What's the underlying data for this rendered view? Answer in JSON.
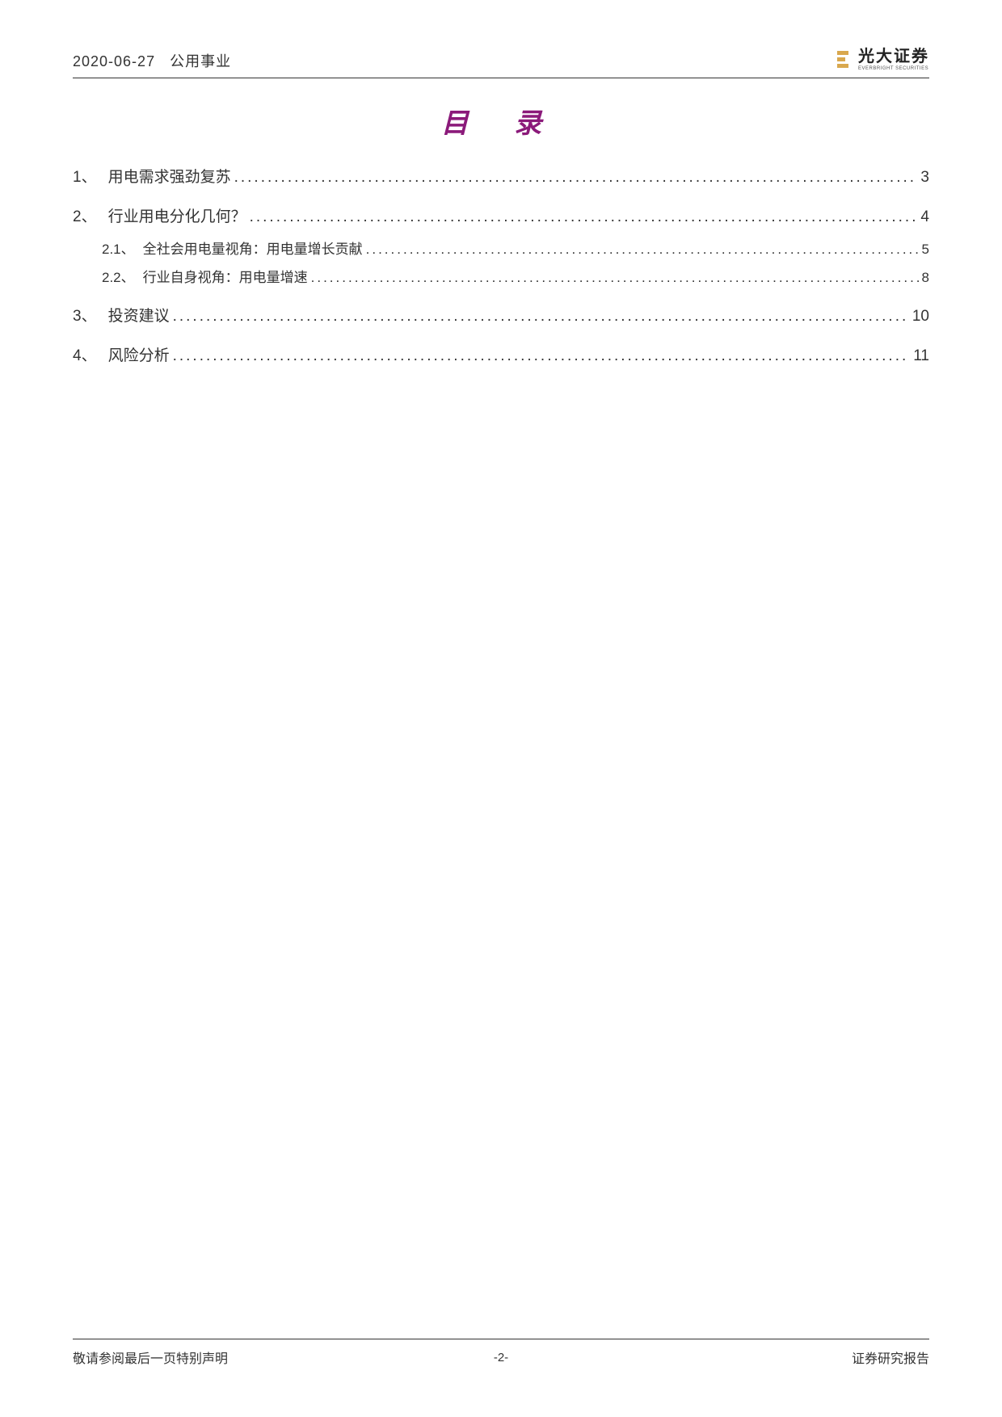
{
  "header": {
    "date": "2020-06-27",
    "category": "公用事业",
    "logo_cn": "光大证券",
    "logo_en": "EVERBRIGHT SECURITIES"
  },
  "title": "目 录",
  "toc": [
    {
      "level": 1,
      "num": "1、",
      "label": "用电需求强劲复苏",
      "page": "3"
    },
    {
      "level": 1,
      "num": "2、",
      "label": "行业用电分化几何？",
      "page": "4"
    },
    {
      "level": 2,
      "num": "2.1、",
      "label": "全社会用电量视角：用电量增长贡献",
      "page": "5"
    },
    {
      "level": 2,
      "num": "2.2、",
      "label": "行业自身视角：用电量增速",
      "page": "8"
    },
    {
      "level": 1,
      "num": "3、",
      "label": "投资建议",
      "page": "10"
    },
    {
      "level": 1,
      "num": "4、",
      "label": "风险分析",
      "page": "11"
    }
  ],
  "footer": {
    "left": "敬请参阅最后一页特别声明",
    "center": "-2-",
    "right": "证券研究报告"
  }
}
